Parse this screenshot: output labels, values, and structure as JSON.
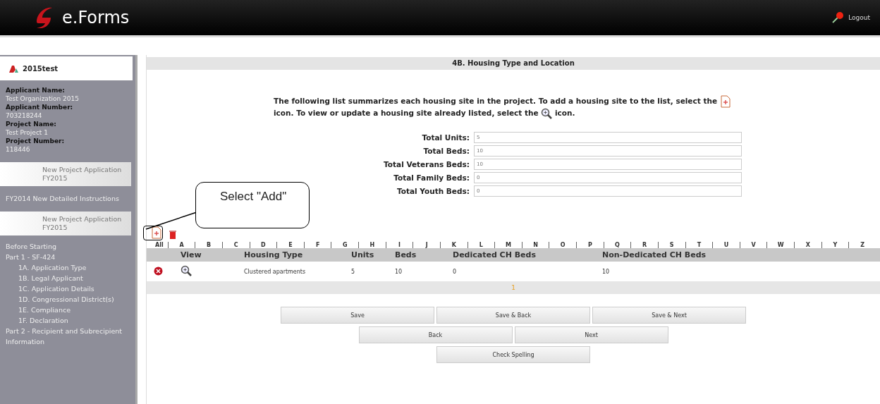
{
  "header": {
    "title": "e.Forms",
    "logout": "Logout"
  },
  "sidebar": {
    "user": "2015test",
    "info": [
      {
        "label": "Applicant Name:",
        "value": "Test Organization 2015"
      },
      {
        "label": "Applicant Number:",
        "value": "703218244"
      },
      {
        "label": "Project Name:",
        "value": "Test Project 1"
      },
      {
        "label": "Project Number:",
        "value": "118446"
      }
    ],
    "sections": [
      {
        "kind": "tab",
        "text": "New Project Application FY2015"
      },
      {
        "kind": "link",
        "text": "FY2014 New Detailed Instructions"
      },
      {
        "kind": "tab",
        "text": "New Project Application FY2015"
      }
    ],
    "nav": [
      {
        "text": "Before Starting"
      },
      {
        "text": "Part 1 - SF-424",
        "children": [
          {
            "text": "1A. Application Type"
          },
          {
            "text": "1B. Legal Applicant"
          },
          {
            "text": "1C. Application Details"
          },
          {
            "text": "1D. Congressional District(s)"
          },
          {
            "text": "1E. Compliance"
          },
          {
            "text": "1F. Declaration"
          }
        ]
      },
      {
        "text": "Part 2 - Recipient and Subrecipient Information"
      }
    ]
  },
  "page": {
    "title": "4B. Housing Type and Location",
    "intro_parts": [
      "The following list summarizes each housing site in the project. To add a housing site to the list, select the",
      "icon. To view or update a housing site already listed, select the",
      "icon."
    ],
    "totals": [
      {
        "label": "Total Units:",
        "value": "5"
      },
      {
        "label": "Total Beds:",
        "value": "10"
      },
      {
        "label": "Total Veterans Beds:",
        "value": "10"
      },
      {
        "label": "Total Family Beds:",
        "value": "0"
      },
      {
        "label": "Total Youth Beds:",
        "value": "0"
      }
    ],
    "callout": "Select \"Add\"",
    "letters": [
      "All",
      "A",
      "B",
      "C",
      "D",
      "E",
      "F",
      "G",
      "H",
      "I",
      "J",
      "K",
      "L",
      "M",
      "N",
      "O",
      "P",
      "Q",
      "R",
      "S",
      "T",
      "U",
      "V",
      "W",
      "X",
      "Y",
      "Z"
    ],
    "table": {
      "columns": [
        "",
        "View",
        "Housing Type",
        "Units",
        "Beds",
        "Dedicated CH Beds",
        "Non-Dedicated CH Beds"
      ],
      "rows": [
        [
          "",
          "",
          "Clustered apartments",
          "5",
          "10",
          "0",
          "10"
        ]
      ]
    },
    "pages": [
      "1"
    ],
    "button_rows": [
      [
        "Save",
        "Save & Back",
        "Save & Next"
      ],
      [
        "Back",
        "Next"
      ],
      [
        "Check Spelling"
      ]
    ]
  }
}
